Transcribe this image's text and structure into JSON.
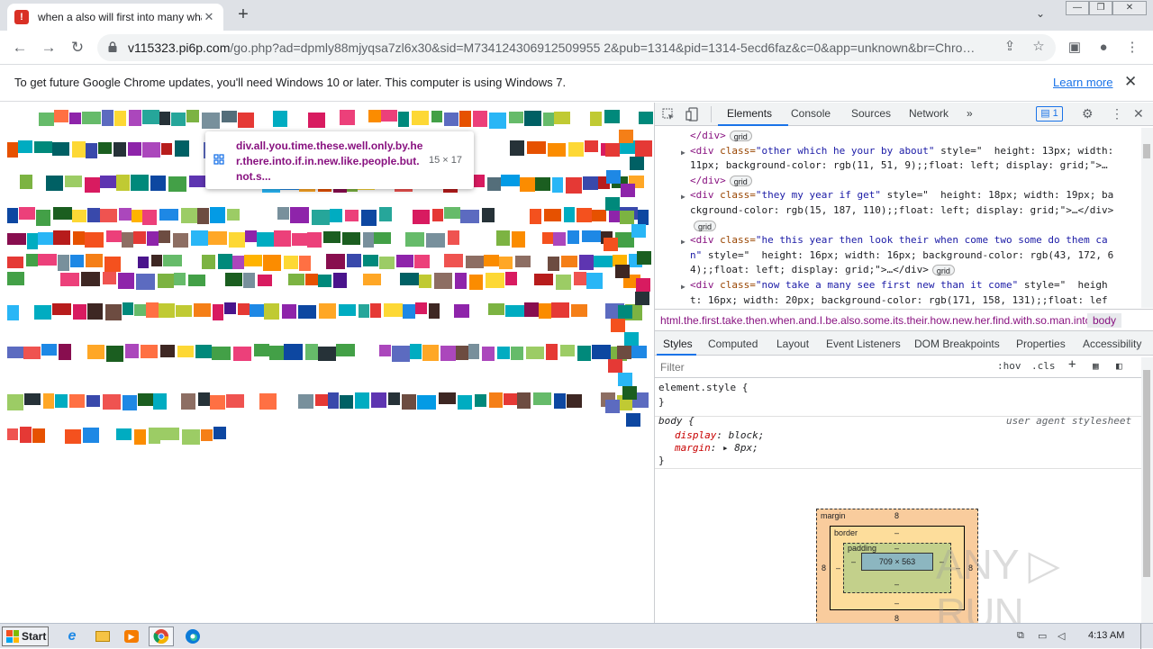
{
  "browser": {
    "tab_title": "when a also will first into many what",
    "favicon_label": "!",
    "tab_close": "✕",
    "new_tab": "+",
    "tab_search": "⌄",
    "window_min": "—",
    "window_restore": "❐",
    "window_close": "✕",
    "url_host": "v115323.pi6p.com",
    "url_rest": "/go.php?ad=dpmly88mjyqsa7zl6x30&sid=M734124306912509955 2&pub=1314&pid=1314-5ecd6faz&c=0&app=unknown&br=Chro…"
  },
  "infobar": {
    "message": "To get future Google Chrome updates, you'll need Windows 10 or later. This computer is using Windows 7.",
    "learn_more": "Learn more",
    "close": "✕"
  },
  "tooltip": {
    "selector": "div.all.you.time.these.well.only.by.her.there.into.if.in.new.like.people.but.not.s...",
    "dimensions": "15 × 17"
  },
  "devtools": {
    "tabs": [
      "Elements",
      "Console",
      "Sources",
      "Network"
    ],
    "more_tabs": "»",
    "issues_count": "1",
    "dom_lines": [
      {
        "tag_open": "</div>",
        "attr": "",
        "val": "",
        "rest": "",
        "badge": "grid",
        "arrow": false
      },
      {
        "tag_open": "<div ",
        "attr": "class=",
        "val": "\"other which he your by about\"",
        "rest": " style=\"  height: 13px; width:",
        "badge": "",
        "arrow": true
      },
      {
        "tag_open": "",
        "attr": "",
        "val": "",
        "rest": "11px; background-color: rgb(11, 51, 9);;float: left; display: grid;\">…",
        "badge": "",
        "arrow": false
      },
      {
        "tag_open": "</div>",
        "attr": "",
        "val": "",
        "rest": "",
        "badge": "grid",
        "arrow": false
      },
      {
        "tag_open": "<div ",
        "attr": "class=",
        "val": "\"they my year if get\"",
        "rest": " style=\"  height: 18px; width: 19px; ba",
        "badge": "",
        "arrow": true
      },
      {
        "tag_open": "",
        "attr": "",
        "val": "",
        "rest": "ckground-color: rgb(15, 187, 110);;float: left; display: grid;\">…</div>",
        "badge": "",
        "arrow": false
      },
      {
        "tag_open": "",
        "attr": "",
        "val": "",
        "rest": "",
        "badge": "grid",
        "arrow": false
      },
      {
        "tag_open": "<div ",
        "attr": "class=",
        "val": "\"he this year then look their when come two some do them ca",
        "rest": "",
        "badge": "",
        "arrow": true
      },
      {
        "tag_open": "",
        "attr": "",
        "val": "n\"",
        "rest": " style=\"  height: 16px; width: 16px; background-color: rgb(43, 172, 6",
        "badge": "",
        "arrow": false
      },
      {
        "tag_open": "",
        "attr": "",
        "val": "",
        "rest": "4);;float: left; display: grid;\">…</div>",
        "badge": "grid",
        "arrow": false
      },
      {
        "tag_open": "<div ",
        "attr": "class=",
        "val": "\"now take a many see first new than it come\"",
        "rest": " style=\"  heigh",
        "badge": "",
        "arrow": true
      },
      {
        "tag_open": "",
        "attr": "",
        "val": "",
        "rest": "t: 16px; width: 20px; background-color: rgb(171, 158, 131);;float: lef",
        "badge": "",
        "arrow": false
      }
    ],
    "breadcrumb_path": "html.the.first.take.then.when.and.I.be.also.some.its.their.how.new.her.find.with.so.man.into",
    "breadcrumb_body": "body",
    "subtabs": [
      "Styles",
      "Computed",
      "Layout",
      "Event Listeners",
      "DOM Breakpoints",
      "Properties",
      "Accessibility"
    ],
    "filter_placeholder": "Filter",
    "hov": ":hov",
    "cls": ".cls",
    "plus": "+",
    "element_style_open": "element.style {",
    "close_brace": "}",
    "body_rule_open": "body {",
    "user_agent": "user agent stylesheet",
    "prop1": "display",
    "val1": "block;",
    "prop2": "margin",
    "val2": "8px;",
    "box_model": {
      "margin_label": "margin",
      "border_label": "border",
      "padding_label": "padding",
      "margin_value": "8",
      "border_value": "–",
      "padding_value": "–",
      "content_size": "709 × 563"
    }
  },
  "watermark": "ANY ▷ RUN",
  "taskbar": {
    "start_label": "Start",
    "clock": "4:13 AM"
  },
  "mosaic_colors": [
    "#e53935",
    "#43a047",
    "#1e88e5",
    "#fdd835",
    "#8e24aa",
    "#00acc1",
    "#fb8c00",
    "#6d4c41",
    "#546e7a",
    "#d81b60",
    "#7cb342",
    "#3949ab",
    "#c0ca33",
    "#00897b",
    "#f4511e",
    "#5e35b1",
    "#039be5",
    "#ffb300",
    "#26a69a",
    "#ec407a",
    "#9ccc65",
    "#5c6bc0",
    "#ff7043",
    "#8d6e63",
    "#ab47bc",
    "#29b6f6",
    "#66bb6a",
    "#ef5350",
    "#ffa726",
    "#78909c",
    "#b71c1c",
    "#1b5e20",
    "#0d47a1",
    "#f57f17",
    "#4a148c",
    "#006064",
    "#e65100",
    "#3e2723",
    "#263238",
    "#880e4f"
  ]
}
